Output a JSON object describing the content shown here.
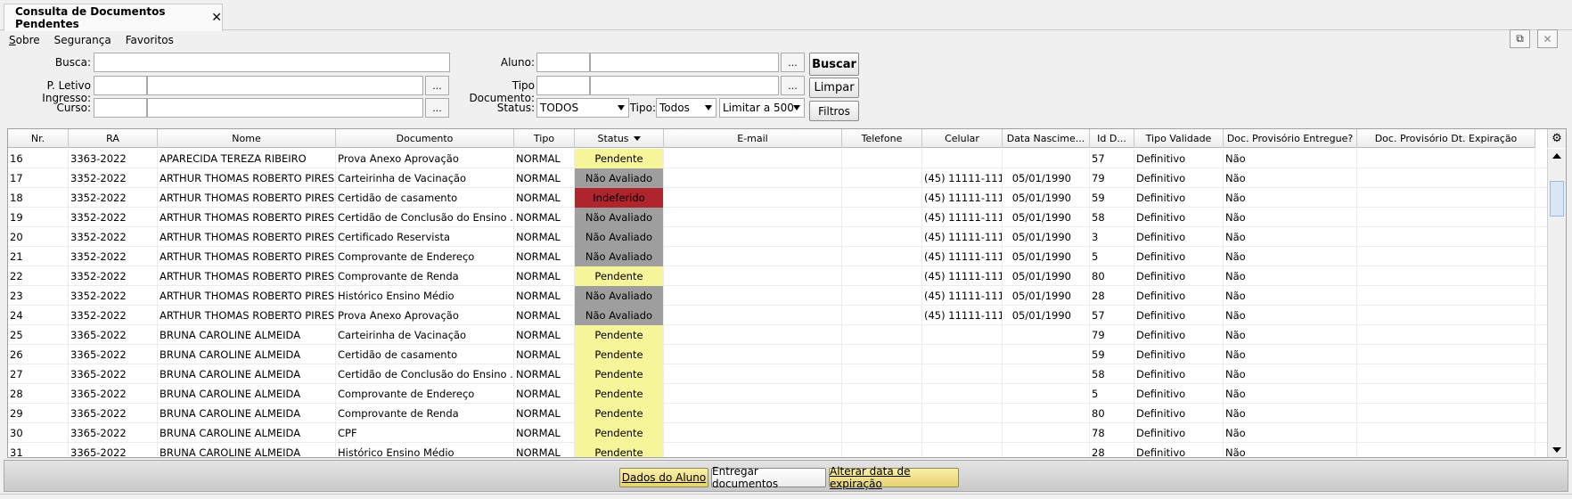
{
  "tab": {
    "title": "Consulta de Documentos Pendentes",
    "close": "✕"
  },
  "menu": {
    "sobre_s": "S",
    "sobre_rest": "obre",
    "seguranca": "Segurança",
    "favoritos": "Favoritos"
  },
  "window": {
    "detach_icon": "⧉",
    "close_icon": "✕"
  },
  "filters": {
    "busca_label": "Busca:",
    "letivo_label": "P. Letivo Ingresso:",
    "curso_label": "Curso:",
    "aluno_label": "Aluno:",
    "tipodoc_label": "Tipo Documento:",
    "status_label": "Status:",
    "status_value": "TODOS",
    "tipo_label": "Tipo:",
    "tipo_value": "Todos",
    "limite_value": "Limitar a 500",
    "dots": "...",
    "buscar": "Buscar",
    "limpar": "Limpar",
    "filtros": "Filtros"
  },
  "grid": {
    "headers": [
      "Nr.",
      "RA",
      "Nome",
      "Documento",
      "Tipo",
      "Status",
      "E-mail",
      "Telefone",
      "Celular",
      "Data Nascime...",
      "Id D...",
      "Tipo Validade",
      "Doc. Provisório Entregue?",
      "Doc. Provisório Dt. Expiração"
    ],
    "gear_icon": "⚙",
    "rows": [
      {
        "nr": "16",
        "ra": "3363-2022",
        "nome": "APARECIDA TEREZA RIBEIRO",
        "doc": "Prova Anexo Aprovação",
        "tipo": "NORMAL",
        "status": "Pendente",
        "email": "",
        "tel": "",
        "cel": "",
        "nasc": "",
        "id": "57",
        "val": "Definitivo",
        "entregue": "Não",
        "exp": ""
      },
      {
        "nr": "17",
        "ra": "3352-2022",
        "nome": "ARTHUR THOMAS ROBERTO PIRES",
        "doc": "Carteirinha de Vacinação",
        "tipo": "NORMAL",
        "status": "Não Avaliado",
        "email": "",
        "tel": "",
        "cel": "(45) 11111-1111",
        "nasc": "05/01/1990",
        "id": "79",
        "val": "Definitivo",
        "entregue": "Não",
        "exp": ""
      },
      {
        "nr": "18",
        "ra": "3352-2022",
        "nome": "ARTHUR THOMAS ROBERTO PIRES",
        "doc": "Certidão de casamento",
        "tipo": "NORMAL",
        "status": "Indeferido",
        "email": "",
        "tel": "",
        "cel": "(45) 11111-1111",
        "nasc": "05/01/1990",
        "id": "59",
        "val": "Definitivo",
        "entregue": "Não",
        "exp": ""
      },
      {
        "nr": "19",
        "ra": "3352-2022",
        "nome": "ARTHUR THOMAS ROBERTO PIRES",
        "doc": "Certidão de Conclusão do Ensino ...",
        "tipo": "NORMAL",
        "status": "Não Avaliado",
        "email": "",
        "tel": "",
        "cel": "(45) 11111-1111",
        "nasc": "05/01/1990",
        "id": "58",
        "val": "Definitivo",
        "entregue": "Não",
        "exp": ""
      },
      {
        "nr": "20",
        "ra": "3352-2022",
        "nome": "ARTHUR THOMAS ROBERTO PIRES",
        "doc": "Certificado Reservista",
        "tipo": "NORMAL",
        "status": "Não Avaliado",
        "email": "",
        "tel": "",
        "cel": "(45) 11111-1111",
        "nasc": "05/01/1990",
        "id": "3",
        "val": "Definitivo",
        "entregue": "Não",
        "exp": ""
      },
      {
        "nr": "21",
        "ra": "3352-2022",
        "nome": "ARTHUR THOMAS ROBERTO PIRES",
        "doc": "Comprovante de Endereço",
        "tipo": "NORMAL",
        "status": "Não Avaliado",
        "email": "",
        "tel": "",
        "cel": "(45) 11111-1111",
        "nasc": "05/01/1990",
        "id": "5",
        "val": "Definitivo",
        "entregue": "Não",
        "exp": ""
      },
      {
        "nr": "22",
        "ra": "3352-2022",
        "nome": "ARTHUR THOMAS ROBERTO PIRES",
        "doc": "Comprovante de Renda",
        "tipo": "NORMAL",
        "status": "Pendente",
        "email": "",
        "tel": "",
        "cel": "(45) 11111-1111",
        "nasc": "05/01/1990",
        "id": "80",
        "val": "Definitivo",
        "entregue": "Não",
        "exp": ""
      },
      {
        "nr": "23",
        "ra": "3352-2022",
        "nome": "ARTHUR THOMAS ROBERTO PIRES",
        "doc": "Histórico Ensino Médio",
        "tipo": "NORMAL",
        "status": "Não Avaliado",
        "email": "",
        "tel": "",
        "cel": "(45) 11111-1111",
        "nasc": "05/01/1990",
        "id": "28",
        "val": "Definitivo",
        "entregue": "Não",
        "exp": ""
      },
      {
        "nr": "24",
        "ra": "3352-2022",
        "nome": "ARTHUR THOMAS ROBERTO PIRES",
        "doc": "Prova Anexo Aprovação",
        "tipo": "NORMAL",
        "status": "Não Avaliado",
        "email": "",
        "tel": "",
        "cel": "(45) 11111-1111",
        "nasc": "05/01/1990",
        "id": "57",
        "val": "Definitivo",
        "entregue": "Não",
        "exp": ""
      },
      {
        "nr": "25",
        "ra": "3365-2022",
        "nome": "BRUNA CAROLINE ALMEIDA",
        "doc": "Carteirinha de Vacinação",
        "tipo": "NORMAL",
        "status": "Pendente",
        "email": "",
        "tel": "",
        "cel": "",
        "nasc": "",
        "id": "79",
        "val": "Definitivo",
        "entregue": "Não",
        "exp": ""
      },
      {
        "nr": "26",
        "ra": "3365-2022",
        "nome": "BRUNA CAROLINE ALMEIDA",
        "doc": "Certidão de casamento",
        "tipo": "NORMAL",
        "status": "Pendente",
        "email": "",
        "tel": "",
        "cel": "",
        "nasc": "",
        "id": "59",
        "val": "Definitivo",
        "entregue": "Não",
        "exp": ""
      },
      {
        "nr": "27",
        "ra": "3365-2022",
        "nome": "BRUNA CAROLINE ALMEIDA",
        "doc": "Certidão de Conclusão do Ensino ...",
        "tipo": "NORMAL",
        "status": "Pendente",
        "email": "",
        "tel": "",
        "cel": "",
        "nasc": "",
        "id": "58",
        "val": "Definitivo",
        "entregue": "Não",
        "exp": ""
      },
      {
        "nr": "28",
        "ra": "3365-2022",
        "nome": "BRUNA CAROLINE ALMEIDA",
        "doc": "Comprovante de Endereço",
        "tipo": "NORMAL",
        "status": "Pendente",
        "email": "",
        "tel": "",
        "cel": "",
        "nasc": "",
        "id": "5",
        "val": "Definitivo",
        "entregue": "Não",
        "exp": ""
      },
      {
        "nr": "29",
        "ra": "3365-2022",
        "nome": "BRUNA CAROLINE ALMEIDA",
        "doc": "Comprovante de Renda",
        "tipo": "NORMAL",
        "status": "Pendente",
        "email": "",
        "tel": "",
        "cel": "",
        "nasc": "",
        "id": "80",
        "val": "Definitivo",
        "entregue": "Não",
        "exp": ""
      },
      {
        "nr": "30",
        "ra": "3365-2022",
        "nome": "BRUNA CAROLINE ALMEIDA",
        "doc": "CPF",
        "tipo": "NORMAL",
        "status": "Pendente",
        "email": "",
        "tel": "",
        "cel": "",
        "nasc": "",
        "id": "78",
        "val": "Definitivo",
        "entregue": "Não",
        "exp": ""
      },
      {
        "nr": "31",
        "ra": "3365-2022",
        "nome": "BRUNA CAROLINE ALMEIDA",
        "doc": "Histórico Ensino Médio",
        "tipo": "NORMAL",
        "status": "Pendente",
        "email": "",
        "tel": "",
        "cel": "",
        "nasc": "",
        "id": "28",
        "val": "Definitivo",
        "entregue": "Não",
        "exp": ""
      }
    ]
  },
  "status_colors": {
    "Pendente": "#f7f59a",
    "Não Avaliado": "#9e9e9e",
    "Indeferido": "#b0252d"
  },
  "actions": {
    "dados_aluno": "Dados do Aluno",
    "entregar": "Entregar documentos",
    "alterar": "Alterar data de expiração"
  }
}
